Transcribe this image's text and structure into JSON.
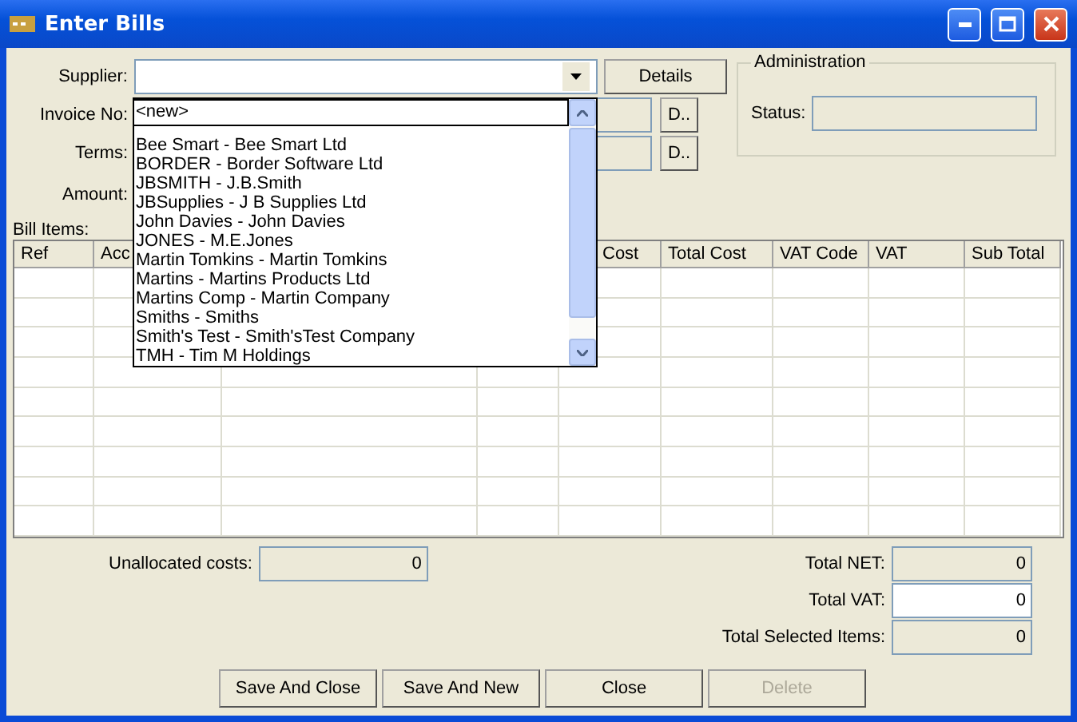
{
  "window": {
    "title": "Enter Bills"
  },
  "fields": [
    {
      "label": "Supplier:",
      "kind": "combo",
      "button": "Details"
    },
    {
      "label": "Invoice No:",
      "kind": "lookup",
      "button": "D.."
    },
    {
      "label": "Terms:",
      "kind": "lookup",
      "button": "D.."
    },
    {
      "label": "Amount:",
      "kind": "label"
    }
  ],
  "administration": {
    "title": "Administration",
    "status_label": "Status:"
  },
  "supplier_dropdown": {
    "items": [
      {
        "label": "<new>",
        "selected": true
      },
      {
        "label": "Bee Smart - Bee Smart Ltd",
        "selected": false
      },
      {
        "label": "BORDER - Border Software Ltd",
        "selected": false
      },
      {
        "label": "JBSMITH - J.B.Smith",
        "selected": false
      },
      {
        "label": "JBSupplies - J B Supplies Ltd",
        "selected": false
      },
      {
        "label": "John Davies - John Davies",
        "selected": false
      },
      {
        "label": "JONES - M.E.Jones",
        "selected": false
      },
      {
        "label": "Martin Tomkins - Martin Tomkins",
        "selected": false
      },
      {
        "label": "Martins - Martins Products Ltd",
        "selected": false
      },
      {
        "label": "Martins Comp - Martin Company",
        "selected": false
      },
      {
        "label": "Smiths - Smiths",
        "selected": false
      },
      {
        "label": "Smith's Test - Smith'sTest Company",
        "selected": false
      },
      {
        "label": "TMH - Tim M Holdings",
        "selected": false
      }
    ]
  },
  "bill_items": {
    "label": "Bill Items:",
    "columns": [
      "Ref",
      "Acc",
      "Cost",
      "Total Cost",
      "VAT Code",
      "VAT",
      "Sub Total"
    ]
  },
  "unallocated": {
    "label": "Unallocated costs:",
    "value": "0"
  },
  "totals": [
    {
      "label": "Total NET:",
      "value": "0",
      "editable": false
    },
    {
      "label": "Total VAT:",
      "value": "0",
      "editable": true
    },
    {
      "label": "Total Selected Items:",
      "value": "0",
      "editable": false
    }
  ],
  "buttons": [
    {
      "label": "Save And Close",
      "disabled": false
    },
    {
      "label": "Save And New",
      "disabled": false
    },
    {
      "label": "Close",
      "disabled": false
    },
    {
      "label": "Delete",
      "disabled": true
    }
  ]
}
